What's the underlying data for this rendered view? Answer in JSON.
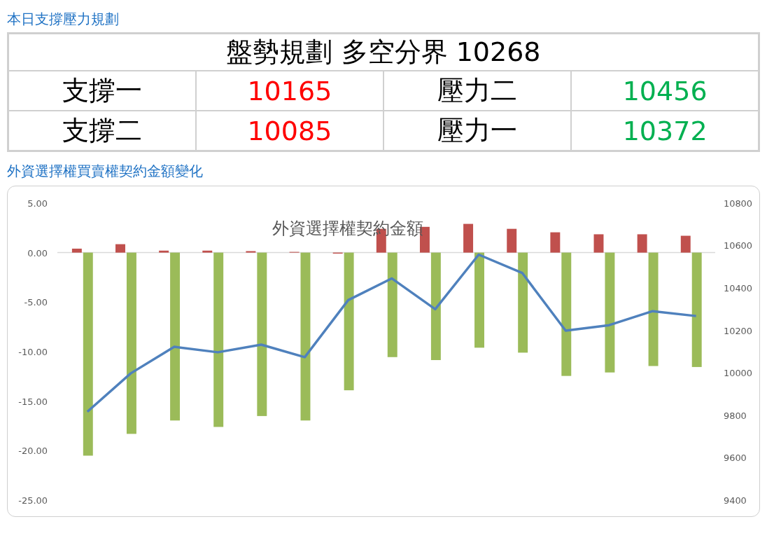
{
  "plan": {
    "heading": "本日支撐壓力規劃",
    "title": "盤勢規劃 多空分界 10268",
    "rows": [
      {
        "cells": [
          {
            "text": "支撐一"
          },
          {
            "text": "10165",
            "color": "#ff0000"
          },
          {
            "text": "壓力二"
          },
          {
            "text": "10456",
            "color": "#00b050"
          }
        ]
      },
      {
        "cells": [
          {
            "text": "支撐二"
          },
          {
            "text": "10085",
            "color": "#ff0000"
          },
          {
            "text": "壓力一"
          },
          {
            "text": "10372",
            "color": "#00b050"
          }
        ]
      }
    ]
  },
  "options": {
    "heading": "外資選擇權買賣權契約金額變化",
    "chart_data": {
      "type": "bar",
      "title": "外資選擇權契約金額",
      "ylim": [
        -25,
        5
      ],
      "yticks": [
        {
          "value": 5,
          "label": "5.00"
        },
        {
          "value": 0,
          "label": "0.00"
        },
        {
          "value": -5,
          "label": "-5.00"
        },
        {
          "value": -10,
          "label": "-10.00"
        },
        {
          "value": -15,
          "label": "-15.00"
        },
        {
          "value": -20,
          "label": "-20.00"
        },
        {
          "value": -25,
          "label": "-25.00"
        }
      ],
      "y2lim": [
        9400,
        10800
      ],
      "y2ticks": [
        10800,
        10600,
        10400,
        10200,
        10000,
        9800,
        9600,
        9400
      ],
      "series": [
        {
          "color": "#c0504d",
          "values": [
            0.4,
            0.85,
            0.2,
            0.2,
            0.15,
            0.07,
            -0.1,
            2.4,
            2.6,
            2.9,
            2.4,
            2.05,
            1.85,
            1.85,
            1.7
          ]
        },
        {
          "color": "#9bbb59",
          "values": [
            -20.5,
            -18.3,
            -16.95,
            -17.6,
            -16.5,
            -16.95,
            -13.9,
            -10.55,
            -10.85,
            -9.6,
            -10.1,
            -12.45,
            -12.1,
            -11.45,
            -11.55
          ]
        },
        {
          "color": "#4f81bd",
          "type": "line",
          "axis": "y2",
          "values": [
            9817,
            9998,
            10123,
            10097,
            10133,
            10074,
            10343,
            10445,
            10300,
            10557,
            10471,
            10199,
            10225,
            10291,
            10268
          ]
        }
      ]
    }
  }
}
